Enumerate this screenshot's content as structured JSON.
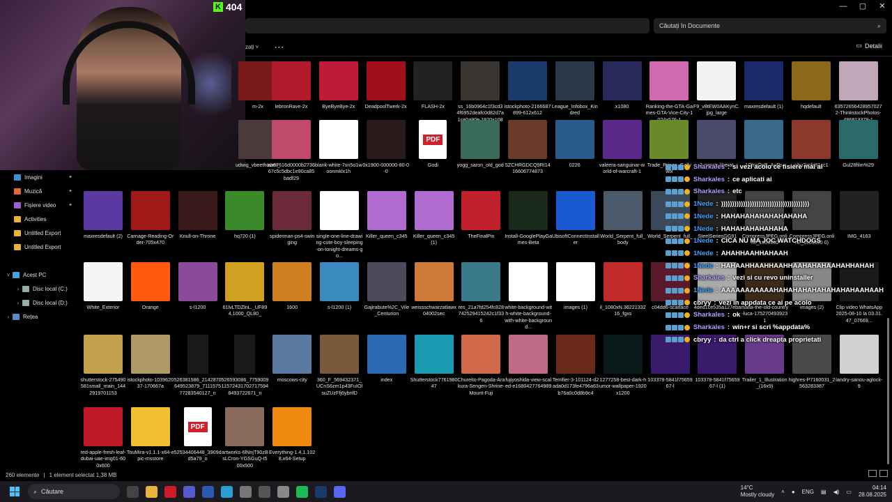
{
  "stream": {
    "viewer_count": "404",
    "logo_letter": "K"
  },
  "window": {
    "minimize": "—",
    "maximize": "▢",
    "close": "✕"
  },
  "search": {
    "placeholder": "Căutați în Documente"
  },
  "toolbar": {
    "sort_label": "zați ˅",
    "more": "⋯",
    "details_label": "Detalii"
  },
  "sidebar": [
    {
      "label": "Imagini",
      "icon": "images-icon",
      "pinned": true,
      "level": 1
    },
    {
      "label": "Muzică",
      "icon": "music-icon",
      "pinned": true,
      "level": 1
    },
    {
      "label": "Fișiere video",
      "icon": "video-icon",
      "pinned": true,
      "level": 1
    },
    {
      "label": "Activities",
      "icon": "folder-icon",
      "pinned": false,
      "level": 1
    },
    {
      "label": "Untitled Export",
      "icon": "folder-icon",
      "pinned": false,
      "level": 1
    },
    {
      "label": "Untitled Export",
      "icon": "folder-icon",
      "pinned": false,
      "level": 1
    },
    {
      "label": "",
      "icon": "",
      "pinned": false,
      "level": 0
    },
    {
      "label": "Acest PC",
      "icon": "pc-icon",
      "pinned": false,
      "level": 0,
      "expanded": true
    },
    {
      "label": "Disc local (C:)",
      "icon": "disk-icon",
      "pinned": false,
      "level": 1
    },
    {
      "label": "Disc local (D:)",
      "icon": "disk-icon",
      "pinned": false,
      "level": 1
    },
    {
      "label": "Rețea",
      "icon": "network-icon",
      "pinned": false,
      "level": 0
    }
  ],
  "rows": [
    [
      {
        "name": "m-2x",
        "color": "#7a1a1a"
      },
      {
        "name": "lebronRave-2x",
        "color": "#b01a2a"
      },
      {
        "name": "ByeByeBye-2x",
        "color": "#c01a3a"
      },
      {
        "name": "DeadpoolTwerk-2x",
        "color": "#a0101a"
      },
      {
        "name": "FLASH-2x",
        "color": "#222"
      },
      {
        "name": "ss_16b0964c1f3cd34f6952deafc0d82d7a1ce0a90e.1920x1080",
        "color": "#3a3530"
      },
      {
        "name": "istockphoto-2166687899-612x612",
        "color": "#1a3a6a"
      },
      {
        "name": "League_Infobox_Kindred",
        "color": "#2a3a4a"
      },
      {
        "name": "x1080",
        "color": "#2a2a5a"
      },
      {
        "name": "Ranking-the-GTA-Games-GTA-Vice-City-1024x576-1",
        "color": "#d06ab0"
      },
      {
        "name": "F9_v8tEW0AAKynC.jpg_large",
        "color": "#f2f2f2"
      },
      {
        "name": "maxresdefault (1)",
        "color": "#1a2a6a"
      },
      {
        "name": "hqdefault",
        "color": "#8a6a1a"
      },
      {
        "name": "635726564289570272-ThinkstockPhotos-486813379-1",
        "color": "#c0a8b8"
      }
    ],
    [
      {
        "name": "udwig_vbeethoven_",
        "color": "#4a3a3a"
      },
      {
        "name": "ab67616d0000b273667c5c5dbc1e90ca85badf29",
        "color": "#c04a6a"
      },
      {
        "name": "blank-white-7sn5o1woonmklx1h",
        "color": "#ffffff"
      },
      {
        "name": "0x1900-000000-80-0-0",
        "color": "#2a1a1a"
      },
      {
        "name": "Godi",
        "color": "#ffffff",
        "pdf": true
      },
      {
        "name": "yogg_saron_old_god",
        "color": "#3a6a5a"
      },
      {
        "name": "SZCHRGDCQ9RI1416606774873",
        "color": "#6a3a2a"
      },
      {
        "name": "0226",
        "color": "#2a5a8a"
      },
      {
        "name": "valeera-sanguinar-world-of-warcraft-1",
        "color": "#5a2a8a"
      },
      {
        "name": "Trade_Prince_Gallywix",
        "color": "#6a8a2a"
      },
      {
        "name": "3-mmstr-liberat",
        "color": "#4a4a6a"
      },
      {
        "name": "1OtroOpE_AuPs",
        "color": "#3a6a8a"
      },
      {
        "name": "wbu3zpbi61cc1",
        "color": "#8a3a2a"
      },
      {
        "name": "Gul28film%29",
        "color": "#2a6a6a"
      }
    ],
    [
      {
        "name": "maxresdefault (2)",
        "color": "#5a3aa0"
      },
      {
        "name": "Carnage-Reading-Order-705x470",
        "color": "#a01a1a"
      },
      {
        "name": "Knull-on-Throne",
        "color": "#3a1a1a"
      },
      {
        "name": "hq720 (1)",
        "color": "#3a8a2a"
      },
      {
        "name": "spiderman-ps4-swinging",
        "color": "#6a2a3a"
      },
      {
        "name": "single-one-line-drawing-cute-boy-sleeping-on-tonight-dreams-go...",
        "color": "#ffffff"
      },
      {
        "name": "Killer_queen_c345",
        "color": "#b06ad0"
      },
      {
        "name": "Killer_queen_c345 (1)",
        "color": "#b06ad0"
      },
      {
        "name": "TheFinalPin",
        "color": "#c0202a"
      },
      {
        "name": "Install-GooglePlayGames-Beta",
        "color": "#1a2a1a"
      },
      {
        "name": "UbisoftConnectInstaller",
        "color": "#1a5ad0"
      },
      {
        "name": "World_Serpent_full_body",
        "color": "#4a5a6a"
      },
      {
        "name": "World_Serpent_full_b",
        "color": "#3a4a5a"
      },
      {
        "name": "SteelSeriesGG91",
        "color": "#222"
      },
      {
        "name": "CompressJPEG.online_1000x50",
        "color": "#444"
      },
      {
        "name": "CompressJPEG.online_1000x50 0)",
        "color": "#444"
      },
      {
        "name": "IMG_4163",
        "color": "#222"
      }
    ],
    [
      {
        "name": "White_Exterior",
        "color": "#f4f4f4"
      },
      {
        "name": "Orange",
        "color": "#ff5a10"
      },
      {
        "name": "s-l1200",
        "color": "#8a4a9a"
      },
      {
        "name": "61lvLTDZlnL._UF894,1000_QL80_",
        "color": "#d0a020"
      },
      {
        "name": "1600",
        "color": "#d08020"
      },
      {
        "name": "s-l1200 (1)",
        "color": "#3a8ac0"
      },
      {
        "name": "Gajirabute%2C_Vile_Centurion",
        "color": "#4a4a5a"
      },
      {
        "name": "weissschwarzatlawx04002sec",
        "color": "#d07a3a"
      },
      {
        "name": "res_21a7fd254fc828742529415242c1f336",
        "color": "#3a7a8a"
      },
      {
        "name": "white-background-with-white-background-with-white-background...",
        "color": "#ffffff"
      },
      {
        "name": "images (1)",
        "color": "#ffffff"
      },
      {
        "name": "il_1080xN.3622133216_fgxs",
        "color": "#c02a2a"
      },
      {
        "name": "c04dd6-scarlace",
        "color": "#5a1a2a"
      },
      {
        "name": "4ded1ce535a127eba",
        "color": "#aaa"
      },
      {
        "name": "mafia-the-old-country-luca-1752704939231",
        "color": "#3a2a1a"
      },
      {
        "name": "images (2)",
        "color": "#888"
      },
      {
        "name": "Clip video WhatsApp 2025-08-10 la 03.31.47_07669...",
        "color": "#1a1a1a"
      }
    ],
    [
      {
        "name": "shutterstock-275490581small_main_1442919701153",
        "color": "#c0a04a"
      },
      {
        "name": "istockphoto-103962037-170667a",
        "color": "#b09a6a"
      },
      {
        "name": "526381586_2142870649523879_711157577283540127_n",
        "color": "#1a1a1a",
        "tall": true
      },
      {
        "name": "526593086_7759009115724317027175948493722671_n",
        "color": "#1a1a1a",
        "tall": true
      },
      {
        "name": "moscows-city",
        "color": "#5a7aa0"
      },
      {
        "name": "360_F_569432371_UCnS6zm1p43FuIOlsuZUzFfj6ybnfD",
        "color": "#7a5a3a"
      },
      {
        "name": "index",
        "color": "#2a6ab0"
      },
      {
        "name": "Shutterstock776198047",
        "color": "#1a9ab0"
      },
      {
        "name": "Chureito-Pagoda-Arakura-Sengen-Shrine-Mount-Fuji",
        "color": "#d06a4a"
      },
      {
        "name": "fujiyoshida-view-scaled-e1680427764989",
        "color": "#c06a8a"
      },
      {
        "name": "Terrifier-3-101124-d2ada0d173fe4796a63b76a0c0d8b9c4",
        "color": "#6a2a1a"
      },
      {
        "name": "1277258-best-dark-humor-wallpaper-1920x1200",
        "color": "#0a1a1a"
      },
      {
        "name": "103378-5841f7565967-l",
        "color": "#3a1a6a"
      },
      {
        "name": "103378-5841f7565967-l (1)",
        "color": "#3a1a6a"
      },
      {
        "name": "Trailer_1_Illustration_(16x9)",
        "color": "#6a3a8a"
      },
      {
        "name": "highres-P7160031_2563283387",
        "color": "#4a4a4a"
      },
      {
        "name": "landry-sanou-aglock-9",
        "color": "#d0d0d0"
      }
    ],
    [
      {
        "name": "red-apple-fresh-leaf-dubai-uae-img01-600x600",
        "color": "#c01a2a"
      },
      {
        "name": "TouMira-v1.1.1-x64-epic-msstore",
        "color": "#f0c030"
      },
      {
        "name": "52534406448_3909dd5a79_o",
        "color": "#ffffff",
        "pdf": true
      },
      {
        "name": "artworks-6lNnjT90zBsLCron-YGSGuQ-t500x500",
        "color": "#8a6a5a"
      },
      {
        "name": "Everything-1.4.1.1028.x64-Setup",
        "color": "#f08a10"
      }
    ]
  ],
  "chat": [
    {
      "user": "Sharkales",
      "kind": "shark",
      "text": "si vezi acolo ce fisiere mai ai"
    },
    {
      "user": "Sharkales",
      "kind": "shark",
      "text": "ce aplicati ai"
    },
    {
      "user": "Sharkales",
      "kind": "shark",
      "text": "etc"
    },
    {
      "user": "1Nede",
      "kind": "nede",
      "text": "))))))))))))))))))))))))))))))))))))))))"
    },
    {
      "user": "1Nede",
      "kind": "nede",
      "text": "HAHAHAHAHAHAHAHAHA"
    },
    {
      "user": "1Nede",
      "kind": "nede",
      "text": "HAHAHAHAHAHAHA"
    },
    {
      "user": "1Nede",
      "kind": "nede",
      "text": "CICA NU MA JOC WATCHDOGS"
    },
    {
      "user": "1Nede",
      "kind": "nede",
      "text": "AHAHHAAHHAHAAH"
    },
    {
      "user": "1Nede",
      "kind": "nede",
      "text": "HAHAAHHAAHHAAHHAAHAHAHAAHAHHAHAH"
    },
    {
      "user": "Sharkales",
      "kind": "shark",
      "text": "vezi si cu revo uninstaller"
    },
    {
      "user": "1Nede",
      "kind": "nede",
      "text": "AAAAAAAAAAAHAHAHAHAHAHAHAHAHAAHAAH"
    },
    {
      "user": "cbryy",
      "kind": "cbryy",
      "text": "vezi in appdata ce ai pe acolo"
    },
    {
      "user": "Sharkales",
      "kind": "shark",
      "text": "ok"
    },
    {
      "user": "Sharkales",
      "kind": "shark",
      "text": "win+r si scri %appdata%"
    },
    {
      "user": "cbryy",
      "kind": "cbryy",
      "text": "da ctrl a click dreapta proprietati"
    }
  ],
  "status": {
    "count": "260 elemente",
    "selected": "1 element selectat  1,38 MB"
  },
  "taskbar": {
    "search_label": "Căutare",
    "weather_temp": "14°C",
    "weather_desc": "Mostly cloudy",
    "lang": "ENG",
    "time": "04:14",
    "date": "28.08.2025",
    "apps": [
      "#444",
      "#e8b43a",
      "#d01a2a",
      "#5a5ad0",
      "#2a5ab0",
      "#2aa0d0",
      "#777",
      "#555",
      "#888",
      "#1db954",
      "#1a3a6a",
      "#5a65f0"
    ]
  }
}
